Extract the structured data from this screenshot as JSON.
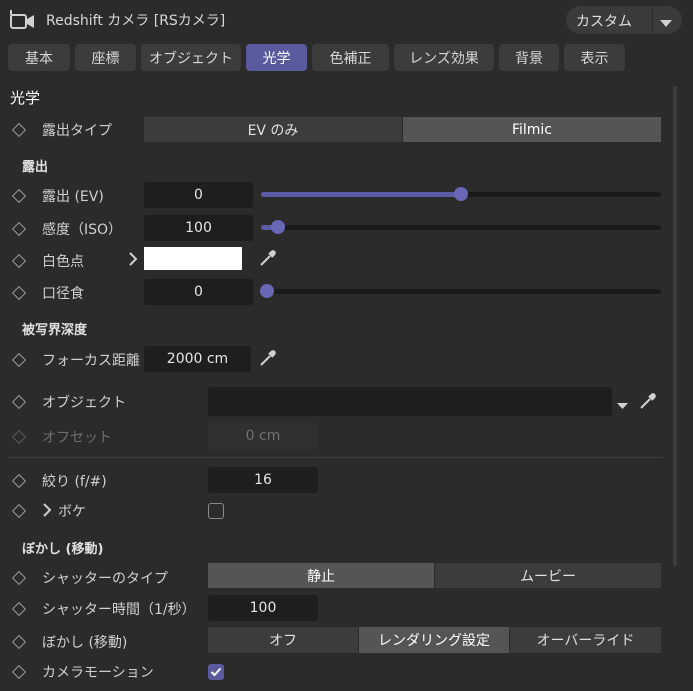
{
  "header": {
    "title": "Redshift カメラ [RSカメラ]",
    "preset": "カスタム"
  },
  "tabs": [
    "基本",
    "座標",
    "オブジェクト",
    "光学",
    "色補正",
    "レンズ効果",
    "背景",
    "表示"
  ],
  "active_tab": "光学",
  "section": "光学",
  "exposure_type": {
    "label": "露出タイプ",
    "options": [
      "EV のみ",
      "Filmic"
    ],
    "selected": "Filmic"
  },
  "exposure_group": "露出",
  "exposure_ev": {
    "label": "露出 (EV)",
    "value": "0",
    "slider_fraction": 0.49
  },
  "iso": {
    "label": "感度（ISO）",
    "value": "100",
    "slider_fraction": 0.04
  },
  "white_point": {
    "label": "白色点",
    "color": "#ffffff"
  },
  "vignetting": {
    "label": "口径食",
    "value": "0",
    "slider_fraction": 0.0
  },
  "dof_group": "被写界深度",
  "focus_distance": {
    "label": "フォーカス距離",
    "value": "2000 cm"
  },
  "object": {
    "label": "オブジェクト",
    "value": ""
  },
  "offset": {
    "label": "オフセット",
    "value": "0 cm"
  },
  "fstop": {
    "label": "絞り (f/#)",
    "value": "16"
  },
  "bokeh": {
    "label": "ボケ",
    "checked": false
  },
  "motion_group": "ぼかし (移動)",
  "shutter_type": {
    "label": "シャッターのタイプ",
    "options": [
      "静止",
      "ムービー"
    ],
    "selected": "静止"
  },
  "shutter_time": {
    "label": "シャッター時間（1/秒）",
    "value": "100"
  },
  "motion_blur": {
    "label": "ぼかし (移動)",
    "options": [
      "オフ",
      "レンダリング設定",
      "オーバーライド"
    ],
    "selected": "レンダリング設定"
  },
  "camera_motion": {
    "label": "カメラモーション",
    "checked": true
  },
  "colors": {
    "accent": "#5a5a9e",
    "slider": "#5b5ba6"
  }
}
